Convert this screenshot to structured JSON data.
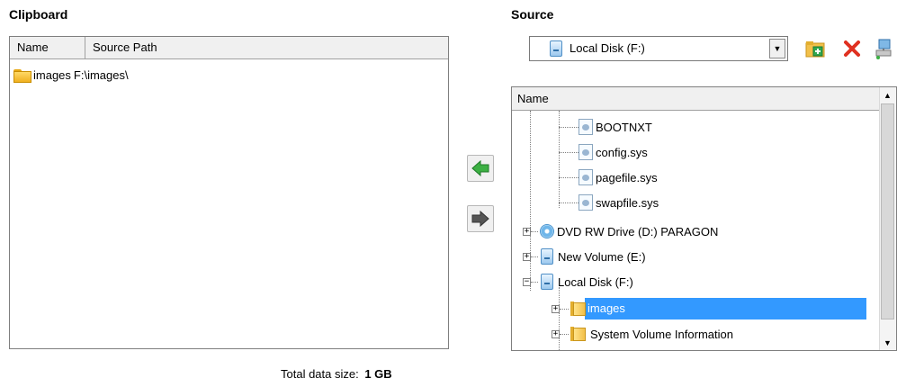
{
  "clipboard": {
    "title": "Clipboard",
    "columns": [
      "Name",
      "Source Path"
    ],
    "rows": [
      {
        "name": "images",
        "path": "F:\\images\\"
      }
    ]
  },
  "source": {
    "title": "Source",
    "drive_selected": "Local Disk (F:)",
    "toolbar_icons": [
      "new-folder-icon",
      "delete-icon",
      "network-drive-icon"
    ],
    "tree_header": "Name",
    "tree": [
      {
        "label": "BOOTNXT",
        "type": "file"
      },
      {
        "label": "config.sys",
        "type": "file"
      },
      {
        "label": "pagefile.sys",
        "type": "file"
      },
      {
        "label": "swapfile.sys",
        "type": "file"
      },
      {
        "label": "DVD RW Drive (D:) PARAGON",
        "type": "dvd"
      },
      {
        "label": "New Volume (E:)",
        "type": "disk"
      },
      {
        "label": "Local Disk (F:)",
        "type": "disk"
      },
      {
        "label": "images",
        "type": "folder",
        "selected": true
      },
      {
        "label": "System Volume Information",
        "type": "folder"
      }
    ]
  },
  "transfer": {
    "add_icon": "arrow-left-icon",
    "remove_icon": "arrow-right-icon"
  },
  "footer": {
    "total_label": "Total data size:",
    "total_value": "1 GB"
  },
  "colors": {
    "selection": "#3399ff",
    "add_arrow": "#3cb043",
    "remove_arrow": "#555555"
  }
}
